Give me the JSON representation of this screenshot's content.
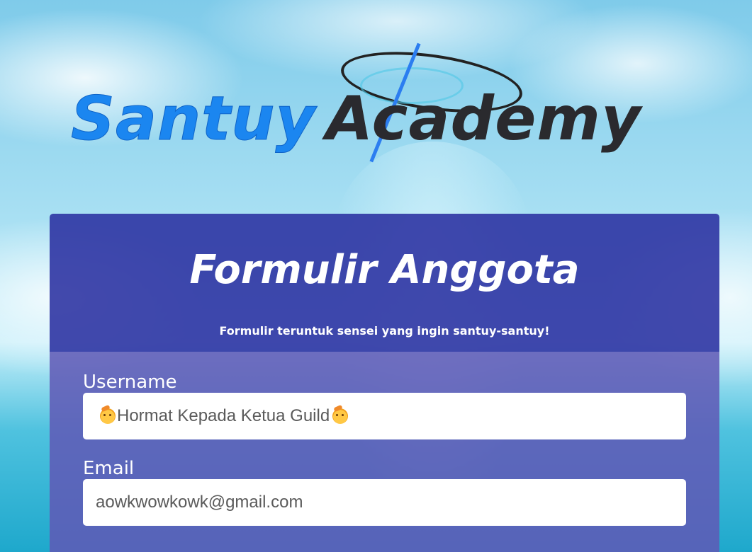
{
  "logo": {
    "word1": "Santuy",
    "word2": "Academy"
  },
  "form": {
    "title": "Formulir Anggota",
    "subtitle": "Formulir teruntuk sensei yang ingin santuy-santuy!",
    "fields": [
      {
        "label": "Username",
        "value": "Hormat Kepada Ketua Guild",
        "leading_icon": "saluting-face-icon",
        "trailing_icon": "saluting-face-icon"
      },
      {
        "label": "Email",
        "value": "aowkwowkowk@gmail.com"
      }
    ]
  },
  "colors": {
    "header_bg": "#2a30a0",
    "body_bg": "#6058b6",
    "logo_blue": "#1b86f0",
    "logo_dark": "#2a2a2e"
  }
}
